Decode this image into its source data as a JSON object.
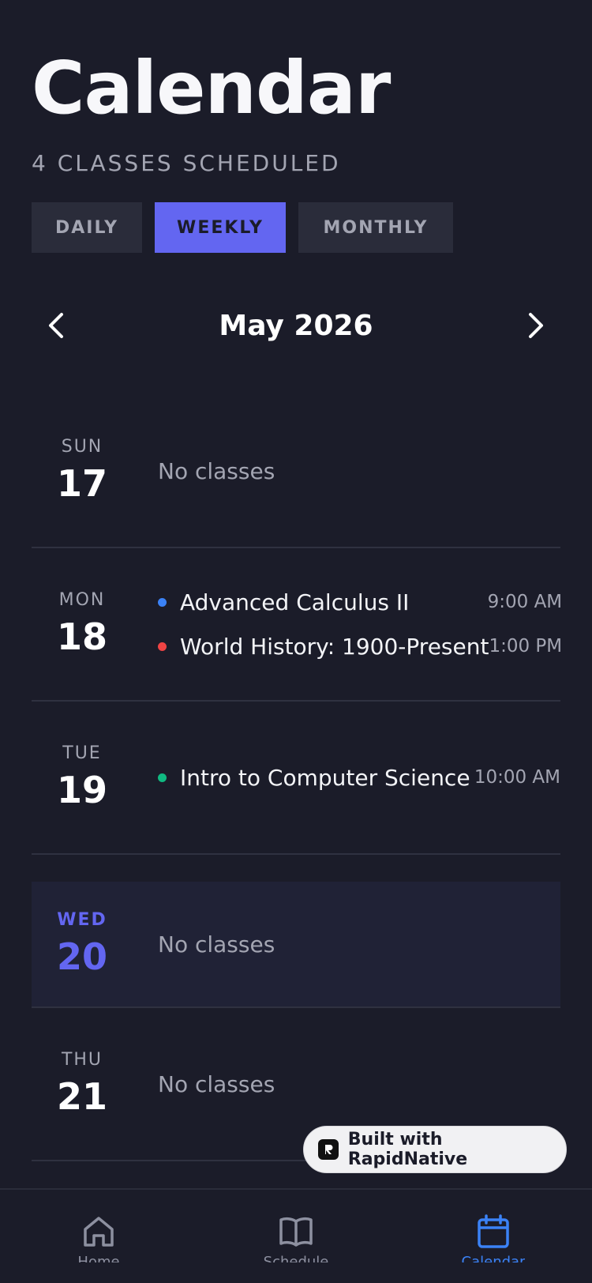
{
  "header": {
    "title": "Calendar",
    "subtitle": "4 CLASSES SCHEDULED"
  },
  "view_tabs": [
    {
      "label": "DAILY",
      "active": false
    },
    {
      "label": "WEEKLY",
      "active": true
    },
    {
      "label": "MONTHLY",
      "active": false
    }
  ],
  "month_nav": {
    "label": "May 2026",
    "prev_icon": "chevron-left-icon",
    "next_icon": "chevron-right-icon"
  },
  "days": [
    {
      "dow": "SUN",
      "num": "17",
      "empty_text": "No classes",
      "events": []
    },
    {
      "dow": "MON",
      "num": "18",
      "events": [
        {
          "title": "Advanced Calculus II",
          "time": "9:00 AM",
          "color": "#3b82f6"
        },
        {
          "title": "World History: 1900-Present",
          "time": "1:00 PM",
          "color": "#ef4444"
        }
      ]
    },
    {
      "dow": "TUE",
      "num": "19",
      "events": [
        {
          "title": "Intro to Computer Science",
          "time": "10:00 AM",
          "color": "#10b981"
        }
      ]
    },
    {
      "dow": "WED",
      "num": "20",
      "today": true,
      "empty_text": "No classes",
      "events": []
    },
    {
      "dow": "THU",
      "num": "21",
      "empty_text": "No classes",
      "events": []
    }
  ],
  "badge": {
    "text": "Built with RapidNative"
  },
  "tabbar": [
    {
      "icon": "home-icon",
      "label": "Home",
      "active": false
    },
    {
      "icon": "book-icon",
      "label": "Schedule",
      "active": false
    },
    {
      "icon": "calendar-icon",
      "label": "Calendar",
      "active": true
    }
  ],
  "colors": {
    "background": "#1b1c29",
    "accent": "#6366f1",
    "tab_active": "#3b82f6",
    "muted": "#a3a5b2"
  }
}
